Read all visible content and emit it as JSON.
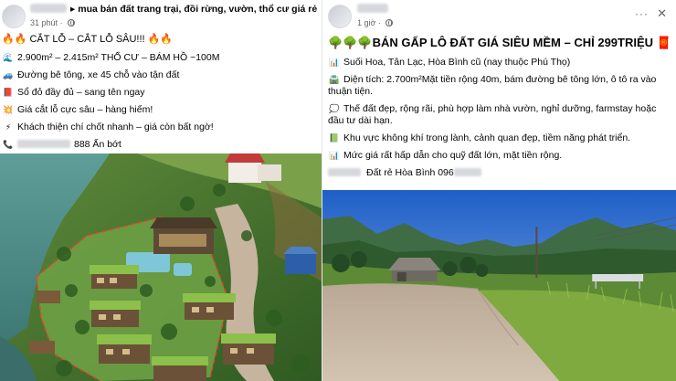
{
  "left_post": {
    "group_name": "mua bán đất trang trại, đồi rừng, vườn, thổ cư giá rẻ",
    "time": "31 phút",
    "headline_prefix": "🔥🔥",
    "headline": "CẮT LỖ – CẮT LỖ SÂU!!!",
    "headline_suffix": "🔥🔥",
    "lines": [
      {
        "icon": "🌊",
        "text": "2.900m² – 2.415m² THỔ CƯ – BÁM HỒ ~100M"
      },
      {
        "icon": "🚙",
        "text": "Đường bê tông, xe 45 chỗ vào tận đất"
      },
      {
        "icon": "📕",
        "text": "Sổ đỏ đầy đủ – sang tên ngay"
      },
      {
        "icon": "💥",
        "text": "Giá cắt lỗ cực sâu – hàng hiếm!"
      },
      {
        "icon": "⚡",
        "text": "Khách thiện chí chốt nhanh – giá còn bất ngờ!"
      }
    ],
    "phone_icon": "📞",
    "phone_tail": "888 Ấn bớt"
  },
  "right_post": {
    "time": "1 giờ",
    "menu_label": "···",
    "close_label": "✕",
    "headline_prefix": "🌳🌳🌳",
    "headline": "BÁN GẤP LÔ ĐẤT GIÁ SIÊU MỀM – CHỈ 299TRIỆU",
    "headline_suffix": "🧧",
    "lines": [
      {
        "icon": "📊",
        "text": "Suối Hoa, Tân Lạc, Hòa Bình cũ (nay thuộc Phú Thọ)"
      },
      {
        "icon": "🛣️",
        "text": "Diện tích: 2.700m²Mặt tiền rộng 40m, bám đường bê tông lớn, ô tô ra vào thuận tiện."
      },
      {
        "icon": "💭",
        "text": "Thế đất đẹp, rộng rãi, phù hợp làm nhà vườn, nghỉ dưỡng, farmstay hoặc đầu tư dài hạn."
      },
      {
        "icon": "📗",
        "text": "Khu vực không khí trong lành, cảnh quan đẹp, tiềm năng phát triển."
      },
      {
        "icon": "📊",
        "text": "Mức giá rất hấp dẫn cho quỹ đất lớn, mặt tiền rộng."
      }
    ],
    "footer_text": "Đất rẻ Hòa Bình 096"
  },
  "colors": {
    "text": "#050505",
    "meta": "#65676b",
    "sky": "#1f5fc7",
    "lake": "#4f8d8a",
    "road": "#c7b49f",
    "boundary": "#e0472a"
  },
  "icons": {
    "avatar": "avatar-circle",
    "globe": "globe-icon",
    "menu": "more-options-icon",
    "close": "close-icon"
  }
}
